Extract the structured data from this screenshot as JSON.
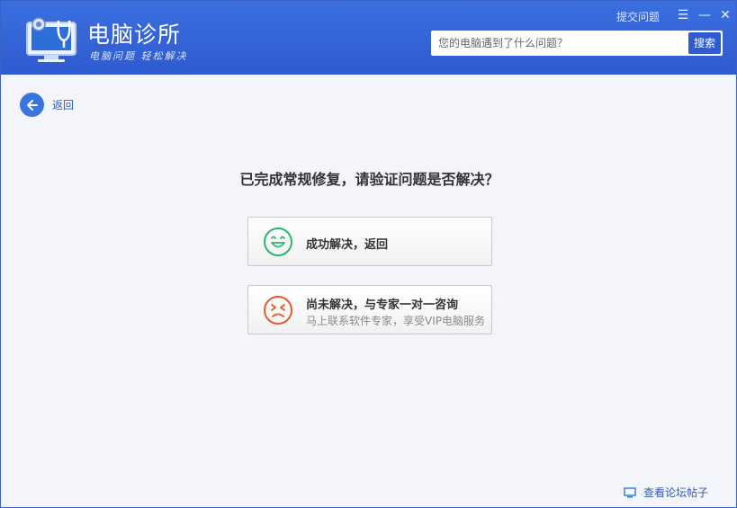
{
  "header": {
    "app_title": "电脑诊所",
    "slogan": "电脑问题 轻松解决",
    "feedback_link": "提交问题",
    "search": {
      "placeholder": "您的电脑遇到了什么问题？",
      "button_label": "搜索"
    }
  },
  "window_controls": {
    "menu": "☰",
    "minimize": "—",
    "close": "✕"
  },
  "nav": {
    "back_label": "返回"
  },
  "main": {
    "question": "已完成常规修复，请验证问题是否解决？",
    "options": [
      {
        "title": "成功解决，返回",
        "icon": "smile-face-icon",
        "color": "#2db56b"
      },
      {
        "title": "尚未解决，与专家一对一咨询",
        "subtitle": "马上联系软件专家，享受VIP电脑服务",
        "icon": "sad-face-icon",
        "color": "#e35d2c"
      }
    ]
  },
  "footer": {
    "link_label": "查看论坛帖子"
  }
}
